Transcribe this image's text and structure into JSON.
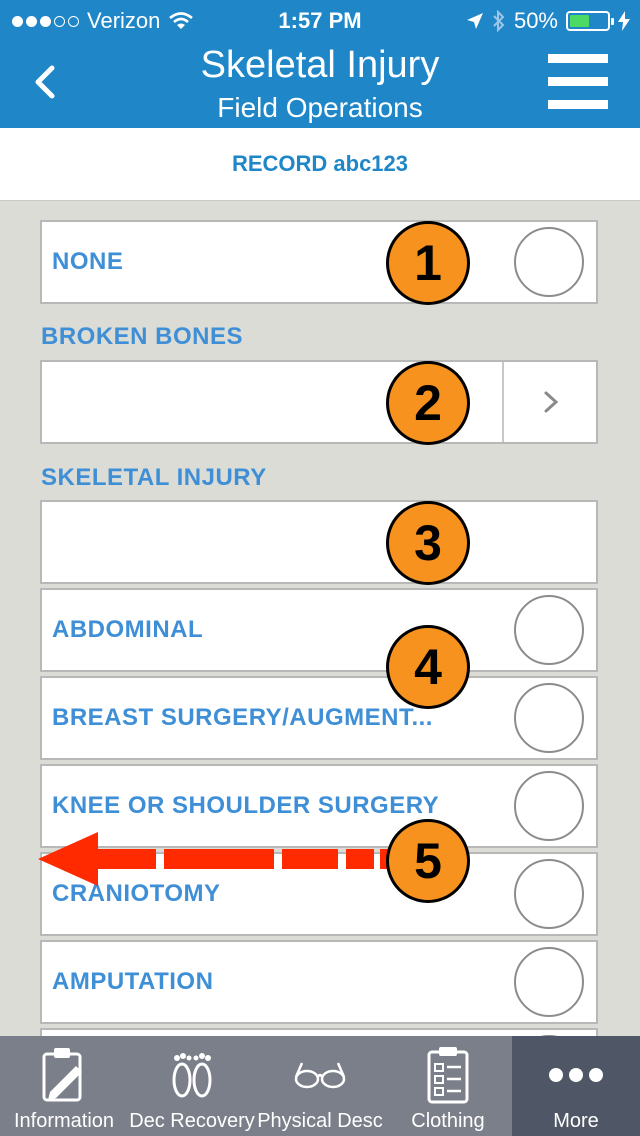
{
  "status_bar": {
    "carrier": "Verizon",
    "time": "1:57 PM",
    "battery": "50%"
  },
  "header": {
    "title": "Skeletal Injury",
    "subtitle": "Field Operations"
  },
  "record": {
    "label": "RECORD abc123"
  },
  "options": {
    "none_label": "NONE",
    "broken_bones_label": "BROKEN BONES",
    "skeletal_injury_label": "SKELETAL INJURY",
    "items": [
      "ABDOMINAL",
      "BREAST SURGERY/AUGMENT...",
      "KNEE OR SHOULDER SURGERY",
      "CRANIOTOMY",
      "AMPUTATION"
    ]
  },
  "annotations": {
    "badges": [
      "1",
      "2",
      "3",
      "4",
      "5"
    ],
    "badge_color": "#f7921e",
    "arrow_color": "#ff2a00"
  },
  "tabbar": {
    "tabs": [
      "Information",
      "Dec Recovery",
      "Physical Desc",
      "Clothing",
      "More"
    ],
    "active": "More"
  },
  "colors": {
    "header": "#1f87c8",
    "label": "#3f8fd7"
  }
}
